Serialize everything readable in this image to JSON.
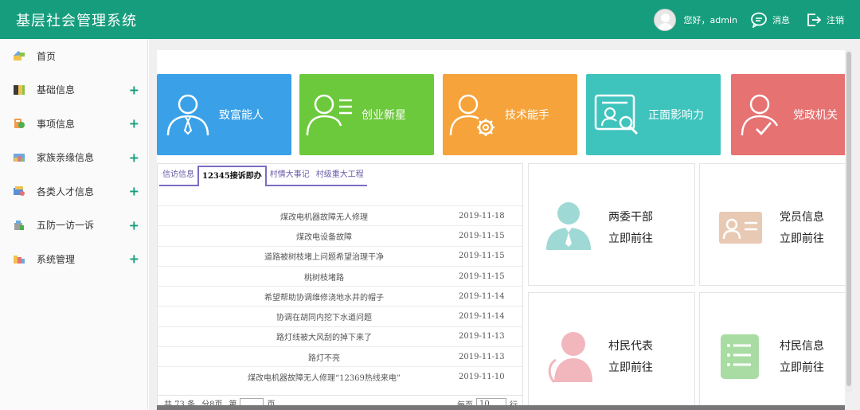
{
  "header": {
    "title": "基层社会管理系统",
    "greeting": "您好，admin",
    "messages_label": "消息",
    "logout_label": "注销",
    "bg_color": "#169d7d"
  },
  "sidebar": {
    "items": [
      {
        "label": "首页",
        "icon": "home-icon",
        "expandable": false
      },
      {
        "label": "基础信息",
        "icon": "book-icon",
        "expandable": true
      },
      {
        "label": "事项信息",
        "icon": "item-icon",
        "expandable": true
      },
      {
        "label": "家族亲缘信息",
        "icon": "family-icon",
        "expandable": true
      },
      {
        "label": "各类人才信息",
        "icon": "talent-icon",
        "expandable": true
      },
      {
        "label": "五防一访一诉",
        "icon": "shield-icon",
        "expandable": true
      },
      {
        "label": "系统管理",
        "icon": "settings-icon",
        "expandable": true
      }
    ],
    "plus": "+"
  },
  "tiles": [
    {
      "label": "致富能人",
      "color": "#3aa1e8",
      "icon": "person-tie-icon"
    },
    {
      "label": "创业新星",
      "color": "#6cc93c",
      "icon": "person-list-icon"
    },
    {
      "label": "技术能手",
      "color": "#f5a33a",
      "icon": "person-gear-icon"
    },
    {
      "label": "正面影响力",
      "color": "#3fc3bd",
      "icon": "id-card-search-icon"
    },
    {
      "label": "党政机关",
      "color": "#e67272",
      "icon": "person-check-icon"
    }
  ],
  "list_panel": {
    "tabs": [
      "信访信息",
      "12345接诉即办",
      "村情大事记",
      "村级重大工程"
    ],
    "active_tab": 1,
    "rows": [
      {
        "title": "煤改电机器故障无人修理",
        "date": "2019-11-18"
      },
      {
        "title": "煤改电设备故障",
        "date": "2019-11-15"
      },
      {
        "title": "道路被树枝堵上问题希望治理干净",
        "date": "2019-11-15"
      },
      {
        "title": "桃树枝堵路",
        "date": "2019-11-15"
      },
      {
        "title": "希望帮助协调维修浇地水井的帽子",
        "date": "2019-11-14"
      },
      {
        "title": "协调在胡同内挖下水道问题",
        "date": "2019-11-14"
      },
      {
        "title": "路灯线被大风刮的掉下来了",
        "date": "2019-11-13"
      },
      {
        "title": "路灯不亮",
        "date": "2019-11-13"
      },
      {
        "title": "煤改电机器故障无人修理“12369热线来电”",
        "date": "2019-11-10"
      }
    ],
    "pager": {
      "total_text": "共 73 条",
      "pages_text": "分8页",
      "goto_prefix": "第",
      "goto_suffix": "页",
      "per_page_label": "每页",
      "per_page_value": "10",
      "per_page_suffix": "行"
    }
  },
  "cards": [
    {
      "title": "两委干部",
      "link": "立即前往",
      "icon": "cadre-icon",
      "color": "#9fd9d6"
    },
    {
      "title": "党员信息",
      "link": "立即前往",
      "icon": "member-card-icon",
      "color": "#e8c9b4"
    },
    {
      "title": "村民代表",
      "link": "立即前往",
      "icon": "representative-icon",
      "color": "#f1b7bd"
    },
    {
      "title": "村民信息",
      "link": "立即前往",
      "icon": "villager-list-icon",
      "color": "#a9dca3"
    }
  ]
}
